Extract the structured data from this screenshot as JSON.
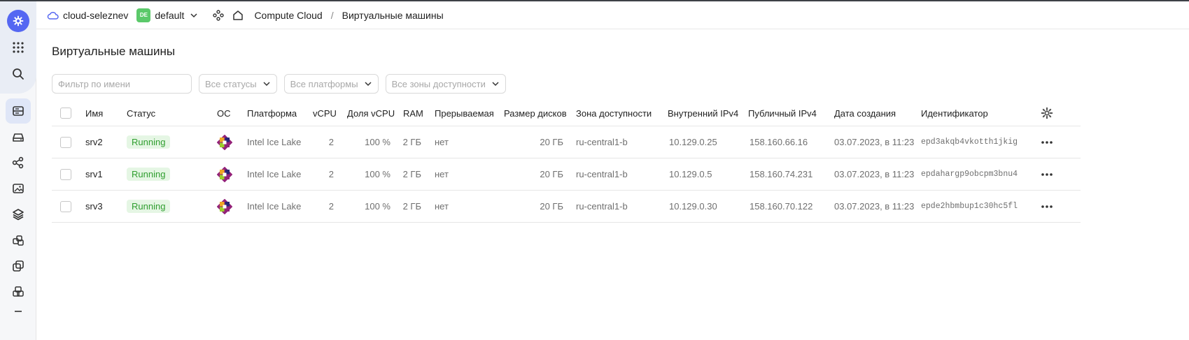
{
  "topbar": {
    "cloud_name": "cloud-seleznev",
    "folder_badge": "DE",
    "folder_name": "default",
    "breadcrumb": [
      "Compute Cloud",
      "Виртуальные машины"
    ],
    "separator": "/"
  },
  "page": {
    "title": "Виртуальные машины"
  },
  "filters": {
    "name_placeholder": "Фильтр по имени",
    "status_select": "Все статусы",
    "platform_select": "Все платформы",
    "zone_select": "Все зоны доступности"
  },
  "table": {
    "columns": {
      "name": "Имя",
      "status": "Статус",
      "os": "ОС",
      "platform": "Платформа",
      "vcpu": "vCPU",
      "vcpu_share": "Доля vCPU",
      "ram": "RAM",
      "preemptible": "Прерываемая",
      "disk_size": "Размер дисков",
      "zone": "Зона доступности",
      "internal_ip": "Внутренний IPv4",
      "public_ip": "Публичный IPv4",
      "created": "Дата создания",
      "id": "Идентификатор"
    },
    "rows": [
      {
        "name": "srv2",
        "status": "Running",
        "os_icon": "centos-icon",
        "platform": "Intel Ice Lake",
        "vcpu": "2",
        "vcpu_share": "100 %",
        "ram": "2 ГБ",
        "preemptible": "нет",
        "disk_size": "20 ГБ",
        "zone": "ru-central1-b",
        "internal_ip": "10.129.0.25",
        "public_ip": "158.160.66.16",
        "created": "03.07.2023, в 11:23",
        "id": "epd3akqb4vkotth1jkig"
      },
      {
        "name": "srv1",
        "status": "Running",
        "os_icon": "centos-icon",
        "platform": "Intel Ice Lake",
        "vcpu": "2",
        "vcpu_share": "100 %",
        "ram": "2 ГБ",
        "preemptible": "нет",
        "disk_size": "20 ГБ",
        "zone": "ru-central1-b",
        "internal_ip": "10.129.0.5",
        "public_ip": "158.160.74.231",
        "created": "03.07.2023, в 11:23",
        "id": "epdahargp9obcpm3bnu4"
      },
      {
        "name": "srv3",
        "status": "Running",
        "os_icon": "centos-icon",
        "platform": "Intel Ice Lake",
        "vcpu": "2",
        "vcpu_share": "100 %",
        "ram": "2 ГБ",
        "preemptible": "нет",
        "disk_size": "20 ГБ",
        "zone": "ru-central1-b",
        "internal_ip": "10.129.0.30",
        "public_ip": "158.160.70.122",
        "created": "03.07.2023, в 11:23",
        "id": "epde2hbmbup1c30hc5fl"
      }
    ]
  },
  "colors": {
    "accent": "#5567f2",
    "status_running_bg": "#e5f6e4",
    "status_running_text": "#2f9e2f",
    "folder_badge": "#5bc96a"
  }
}
